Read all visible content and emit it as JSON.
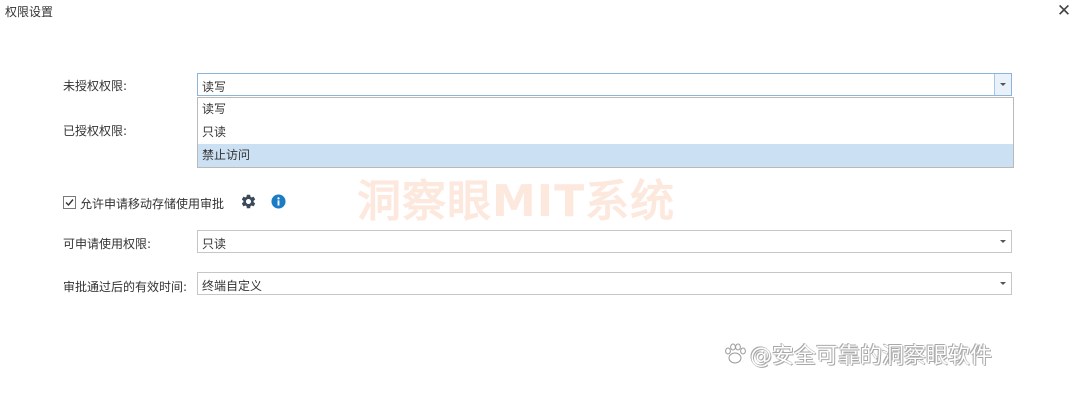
{
  "window": {
    "title": "权限设置"
  },
  "form": {
    "unauthorized_label": "未授权权限:",
    "unauthorized_value": "读写",
    "authorized_label": "已授权权限:",
    "dropdown_options": [
      "读写",
      "只读",
      "禁止访问"
    ],
    "dropdown_selected_index": 2,
    "allow_checkbox_label": "允许申请移动存储使用审批",
    "allow_checkbox_checked": true,
    "request_label": "可申请使用权限:",
    "request_value": "只读",
    "approval_time_label": "审批通过后的有效时间:",
    "approval_time_value": "终端自定义"
  },
  "overlay": {
    "watermark": "洞察眼MIT系统",
    "credit": "@安全可靠的洞察眼软件"
  },
  "icons": [
    "close-icon",
    "dropdown-arrow-icon",
    "gear-icon",
    "info-icon",
    "checkmark-icon",
    "paw-icon"
  ],
  "colors": {
    "selection": "#cce0f4",
    "info": "#1a7cc4",
    "gear": "#3a4a5a",
    "watermark": "#f8bea0"
  }
}
